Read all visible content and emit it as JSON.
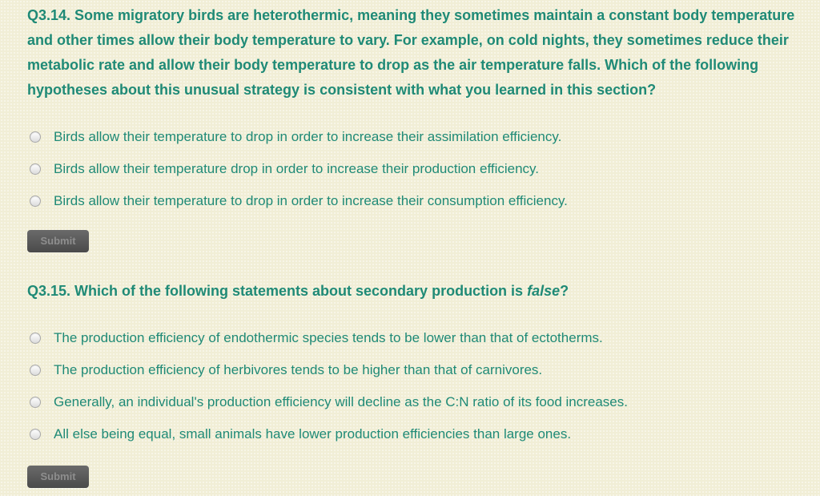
{
  "q1": {
    "lines": [
      "Q3.14. Some migratory birds are heterothermic, meaning they sometimes maintain a constant body temperature",
      "and other times allow their body temperature to vary. For example, on cold nights, they sometimes reduce their",
      "metabolic rate and allow their body temperature to drop as the air temperature falls. Which of the following",
      "hypotheses about this unusual strategy is consistent with what you learned in this section?"
    ],
    "options": [
      "Birds allow their temperature to drop in order to increase their assimilation efficiency.",
      "Birds allow their temperature drop in order to increase their production efficiency.",
      "Birds allow their temperature to drop in order to increase their consumption efficiency."
    ],
    "submit_label": "Submit"
  },
  "q2": {
    "text_before": "Q3.15. Which of the following statements about secondary production is ",
    "text_emphasis": "false",
    "text_after": "?",
    "options": [
      "The production efficiency of endothermic species tends to be lower than that of ectotherms.",
      "The production efficiency of herbivores tends to be higher than that of carnivores.",
      "Generally, an individual's production efficiency will decline as the C:N ratio of its food increases.",
      "All else being equal, small animals have lower production efficiencies than large ones."
    ],
    "submit_label": "Submit"
  },
  "colors": {
    "text": "#1f8a76",
    "background": "#f1eed6",
    "button": "#555555"
  }
}
